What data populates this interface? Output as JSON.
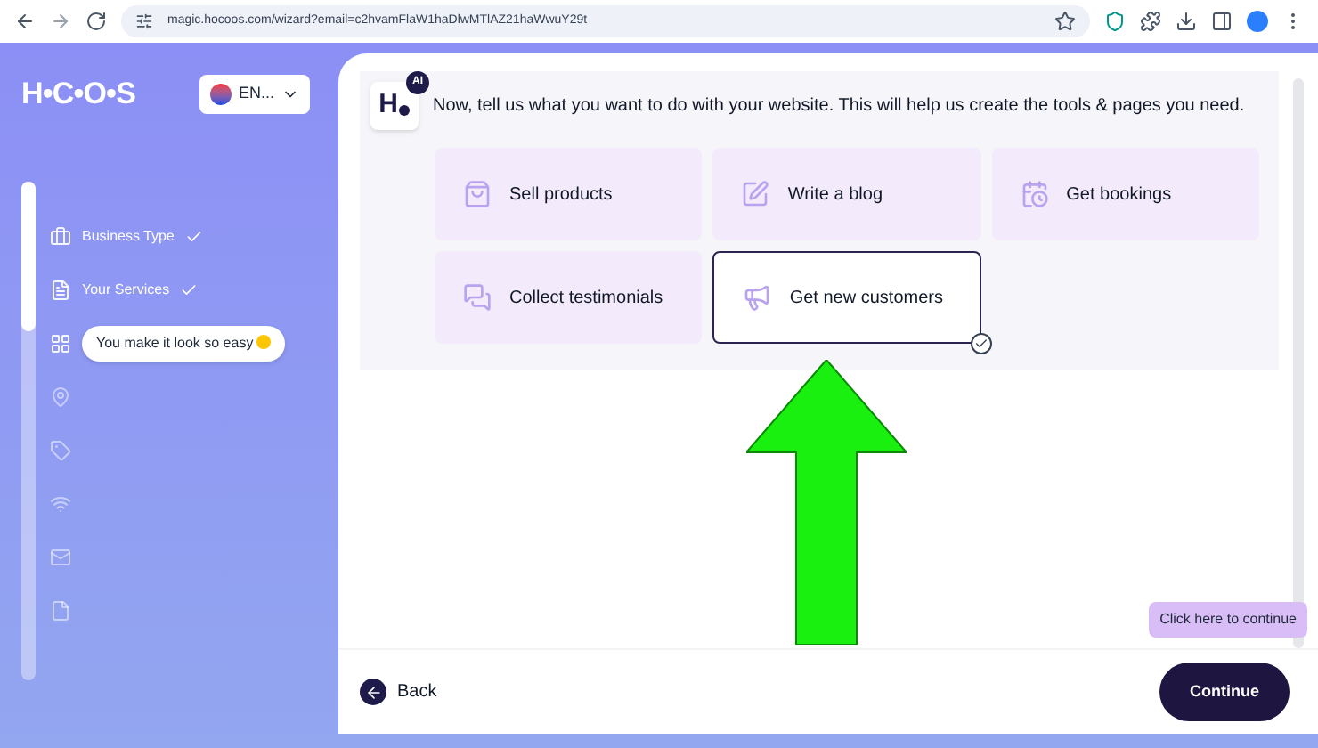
{
  "browser": {
    "url": "magic.hocoos.com/wizard?email=c2hvamFlaW1haDlwMTlAZ21haWwuY29t"
  },
  "sidebar": {
    "logo": "H•C•O•S",
    "language": "EN...",
    "progress": {
      "level": 0.3
    },
    "steps": [
      {
        "kind": "done",
        "label": "Business Type"
      },
      {
        "kind": "done",
        "label": "Your Services"
      },
      {
        "kind": "current",
        "label": "You make it look so easy"
      },
      {
        "kind": "pending"
      },
      {
        "kind": "pending"
      },
      {
        "kind": "pending"
      },
      {
        "kind": "pending"
      },
      {
        "kind": "pending"
      }
    ]
  },
  "chat": {
    "avatar": "H",
    "badge": "AI",
    "message": "Now, tell us what you want to do with your website. This will help us create the tools & pages you need.",
    "options": [
      {
        "label": "Sell products",
        "selected": false
      },
      {
        "label": "Write a blog",
        "selected": false
      },
      {
        "label": "Get bookings",
        "selected": false
      },
      {
        "label": "Collect testimonials",
        "selected": false
      },
      {
        "label": "Get new customers",
        "selected": true
      }
    ]
  },
  "footer": {
    "back": "Back",
    "tooltip": "Click here to continue",
    "continue": "Continue"
  }
}
